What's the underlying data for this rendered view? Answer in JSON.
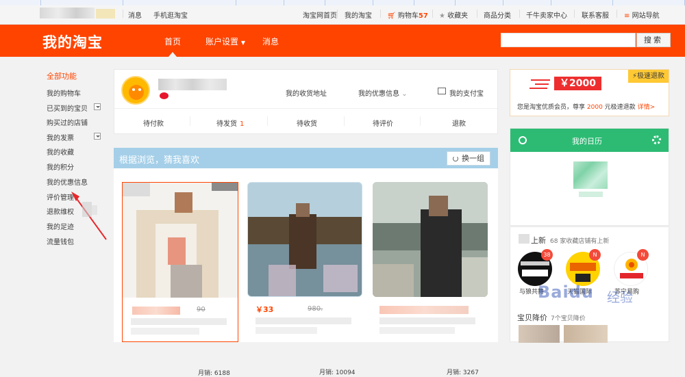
{
  "topbar": {
    "messages": "消息",
    "mobile": "手机逛淘宝",
    "home": "淘宝网首页",
    "my_taobao": "我的淘宝",
    "cart_label": "购物车",
    "cart_count": "57",
    "favorites": "收藏夹",
    "categories": "商品分类",
    "seller_center": "千牛卖家中心",
    "support": "联系客服",
    "site_nav": "网站导航"
  },
  "header": {
    "logo": "我的淘宝",
    "nav": [
      "首页",
      "账户设置",
      "消息"
    ],
    "search_button": "搜索",
    "search_placeholder": ""
  },
  "sidebar": {
    "title": "全部功能",
    "items": [
      "我的购物车",
      "已买到的宝贝",
      "购买过的店铺",
      "我的发票",
      "我的收藏",
      "我的积分",
      "我的优惠信息",
      "评价管理",
      "退款维权",
      "我的足迹",
      "流量钱包"
    ]
  },
  "profile": {
    "address": "我的收货地址",
    "discounts": "我的优惠信息",
    "alipay": "我的支付宝",
    "status": [
      {
        "label": "待付款",
        "count": ""
      },
      {
        "label": "待发货",
        "count": "1"
      },
      {
        "label": "待收货",
        "count": ""
      },
      {
        "label": "待评价",
        "count": ""
      },
      {
        "label": "退款",
        "count": ""
      }
    ]
  },
  "guess": {
    "title": "根据浏览，猜我喜欢",
    "swap": "换一组",
    "cards": [
      {
        "price": "",
        "orig": "90",
        "sold": "月销: 6188"
      },
      {
        "price": "￥33",
        "orig": "980.",
        "sold": "月销: 10094"
      },
      {
        "price": "",
        "orig": "",
        "sold": "月销: 3267"
      }
    ]
  },
  "promo": {
    "amount": "￥2000",
    "badge": "极速退款",
    "text_prefix": "您是淘宝优质会员，尊享",
    "text_amount": "2000",
    "text_suffix": "元极速退款",
    "details": "详情>"
  },
  "calendar": {
    "title": "我的日历"
  },
  "new_arrivals": {
    "title": "上新",
    "subtitle": "68 家收藏店铺有上新",
    "brands": [
      {
        "name": "与狼共舞",
        "badge": "38"
      },
      {
        "name": "天猫国际",
        "badge": "N"
      },
      {
        "name": "苏宁易购",
        "badge": "N"
      }
    ],
    "drop_title": "宝贝降价",
    "drop_sub": "7个宝贝降价"
  },
  "watermark": {
    "brand": "Baidu",
    "suffix": "经验"
  },
  "colors": {
    "accent": "#ff4400",
    "guess_header": "#a5cfe8",
    "calendar_header": "#2dbb74",
    "promo_red": "#ee2e2e"
  }
}
